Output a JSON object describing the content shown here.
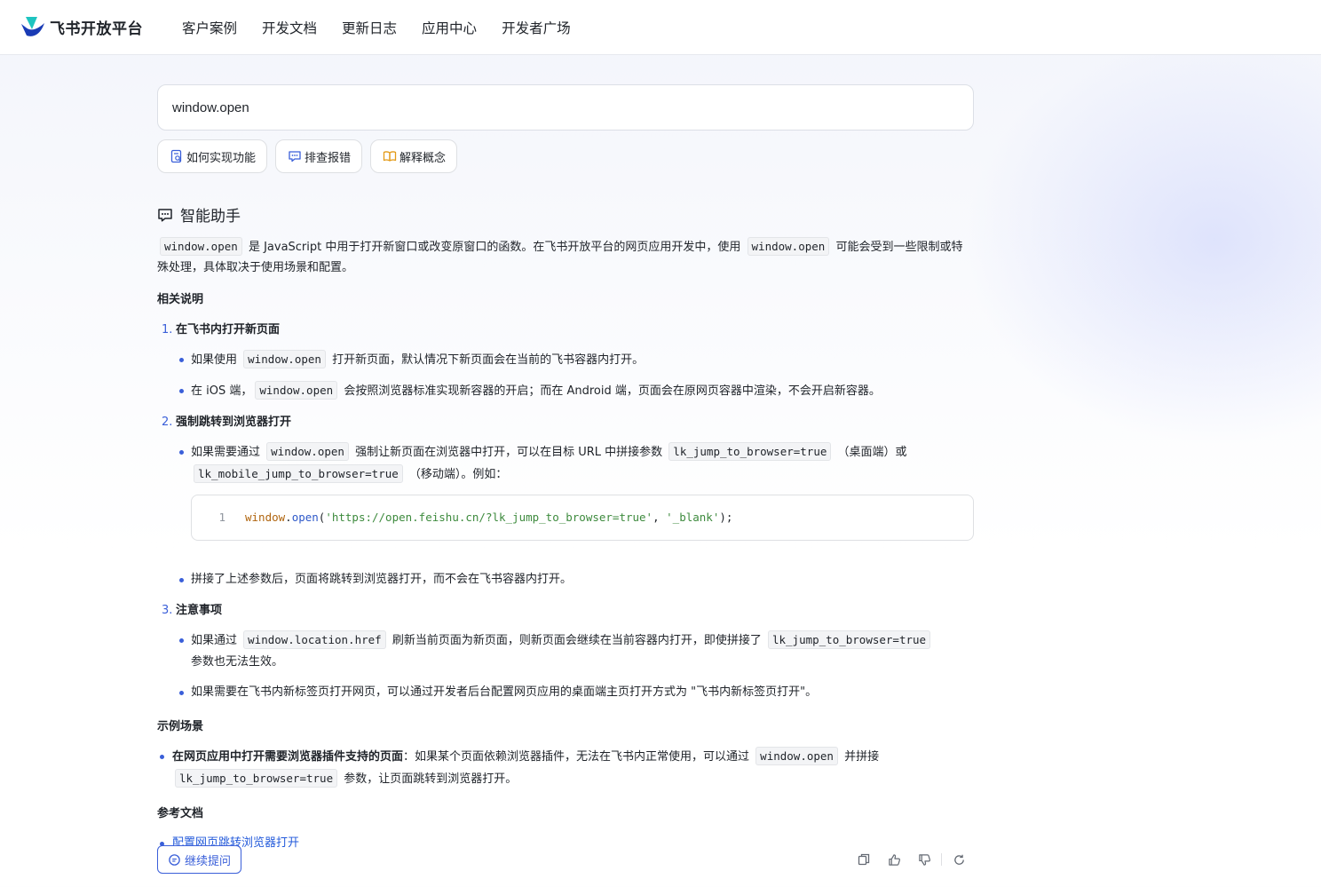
{
  "header": {
    "logo_text": "飞书开放平台",
    "nav": [
      "客户案例",
      "开发文档",
      "更新日志",
      "应用中心",
      "开发者广场"
    ]
  },
  "search": {
    "value": "window.open"
  },
  "quick_tags": [
    {
      "label": "如何实现功能",
      "icon": "doc-search-icon"
    },
    {
      "label": "排查报错",
      "icon": "chat-bug-icon"
    },
    {
      "label": "解释概念",
      "icon": "book-icon"
    }
  ],
  "assistant": {
    "title": "智能助手",
    "intro": {
      "code1": "window.open",
      "t1": "是 JavaScript 中用于打开新窗口或改变原窗口的函数。在飞书开放平台的网页应用开发中，使用",
      "code2": "window.open",
      "t2": "可能会受到一些限制或特殊处理，具体取决于使用场景和配置。"
    },
    "related_heading": "相关说明",
    "items": [
      {
        "num": "1.",
        "title": "在飞书内打开新页面",
        "b1": {
          "pre": "如果使用",
          "code": "window.open",
          "post": "打开新页面，默认情况下新页面会在当前的飞书容器内打开。"
        },
        "b2": {
          "pre": "在 iOS 端，",
          "code": "window.open",
          "post": "会按照浏览器标准实现新容器的开启；而在 Android 端，页面会在原网页容器中渲染，不会开启新容器。"
        }
      },
      {
        "num": "2.",
        "title": "强制跳转到浏览器打开",
        "b1": {
          "pre": "如果需要通过",
          "code": "window.open",
          "mid": "强制让新页面在浏览器中打开，可以在目标 URL 中拼接参数",
          "code2": "lk_jump_to_browser=true",
          "mid2": "（桌面端）或",
          "code3": "lk_mobile_jump_to_browser=true",
          "post": "（移动端）。例如："
        },
        "code_line_no": "1",
        "code_tokens": {
          "obj": "window",
          "dot": ".",
          "fn": "open",
          "lp": "(",
          "arg1": "'https://open.feishu.cn/?lk_jump_to_browser=true'",
          "comma": ", ",
          "arg2": "'_blank'",
          "rp": ");"
        },
        "b2": "拼接了上述参数后，页面将跳转到浏览器打开，而不会在飞书容器内打开。"
      },
      {
        "num": "3.",
        "title": "注意事项",
        "b1": {
          "pre": "如果通过",
          "code": "window.location.href",
          "mid": "刷新当前页面为新页面，则新页面会继续在当前容器内打开，即使拼接了",
          "code2": "lk_jump_to_browser=true",
          "post": "参数也无法生效。"
        },
        "b2": "如果需要在飞书内新标签页打开网页，可以通过开发者后台配置网页应用的桌面端主页打开方式为 \"飞书内新标签页打开\"。"
      }
    ],
    "example_heading": "示例场景",
    "example": {
      "bold": "在网页应用中打开需要浏览器插件支持的页面",
      "pre": "：如果某个页面依赖浏览器插件，无法在飞书内正常使用，可以通过",
      "code": "window.open",
      "mid": "并拼接",
      "code2": "lk_jump_to_browser=true",
      "post": "参数，让页面跳转到浏览器打开。"
    },
    "refs_heading": "参考文档",
    "refs": [
      "配置网页跳转浏览器打开"
    ]
  },
  "bottom": {
    "follow_up": "继续提问",
    "actions": [
      "copy-icon",
      "thumbs-up-icon",
      "thumbs-down-icon",
      "refresh-icon"
    ]
  },
  "colors": {
    "accent": "#3a5fd9",
    "link": "#245bdb",
    "text": "#1f2329"
  }
}
